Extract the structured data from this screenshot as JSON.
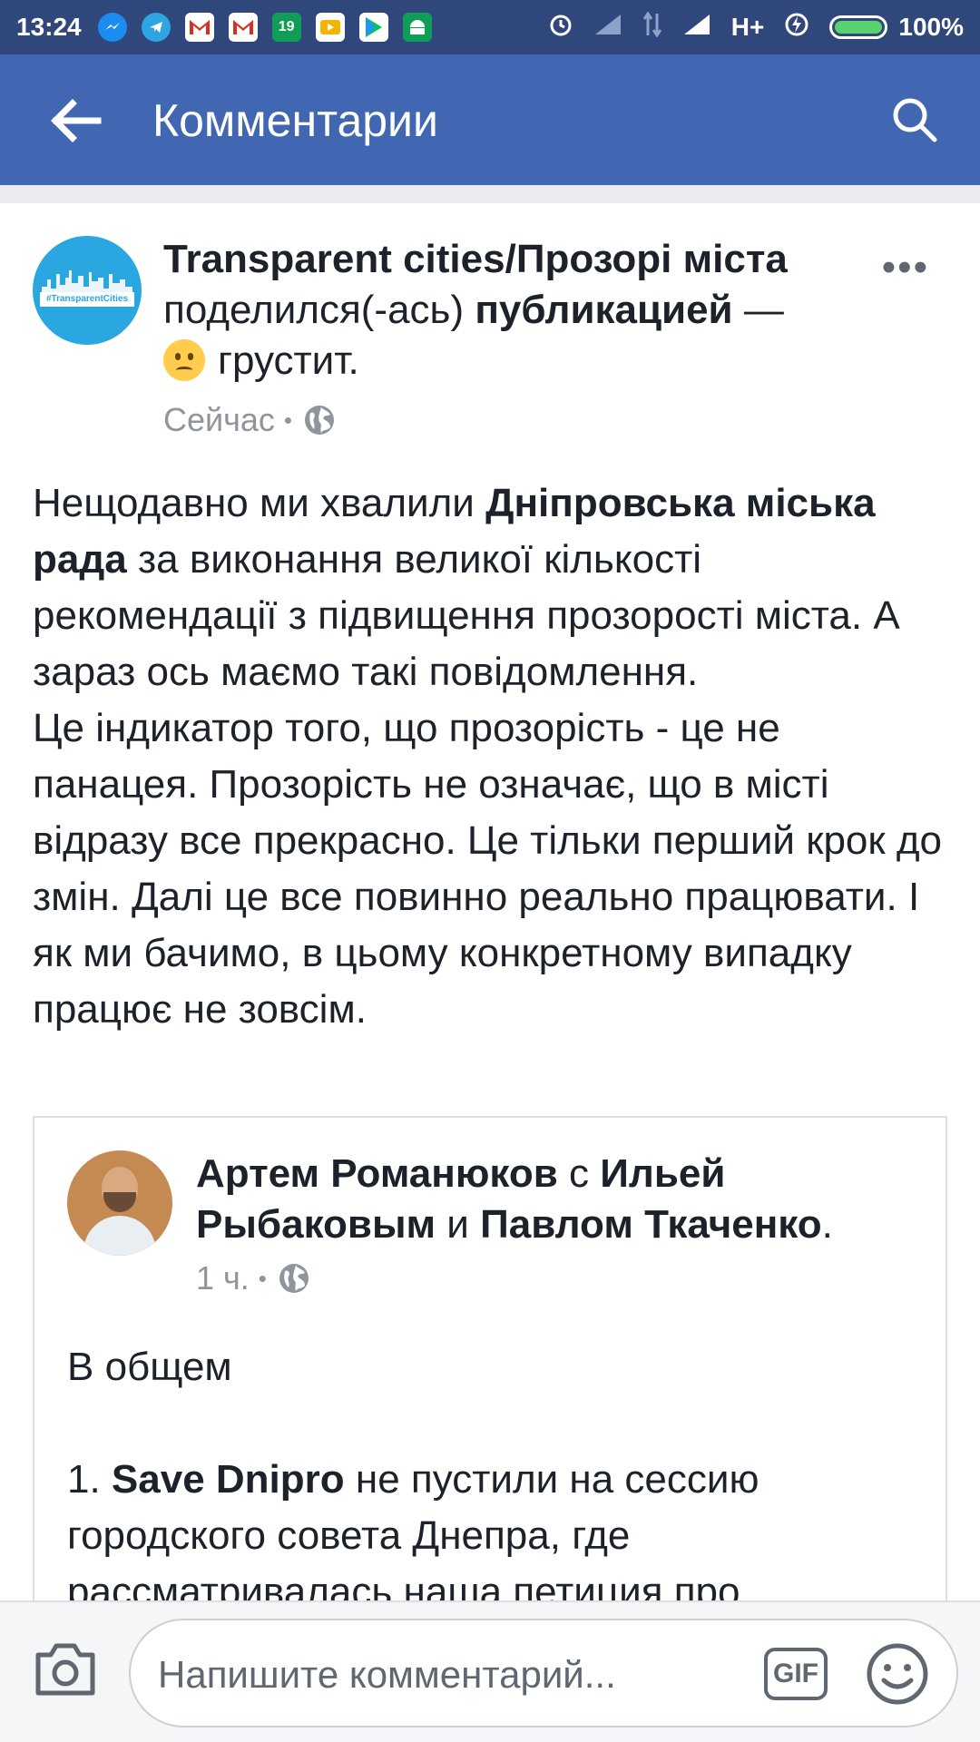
{
  "status_bar": {
    "time": "13:24",
    "notification_icons": [
      "messenger-icon",
      "telegram-icon",
      "gmail-icon",
      "gmail-icon",
      "calendar-icon",
      "slides-icon",
      "play-store-icon",
      "android-icon"
    ],
    "calendar_day": "19",
    "network_label": "H+",
    "battery_percent": "100%"
  },
  "app_bar": {
    "title": "Комментарии",
    "back_icon": "back-arrow-icon",
    "search_icon": "search-icon"
  },
  "post": {
    "author": "Transparent cities/Прозорі міста",
    "action": "поделился(-ась)",
    "object": "публикацией",
    "dash": " —",
    "feeling": "грустит.",
    "time": "Сейчас",
    "separator": "•",
    "avatar_tag": "#TransparentCities",
    "paragraphs": {
      "p1_pre": "Нещодавно ми хвалили ",
      "p1_bold": "Дніпровська міська рада",
      "p1_post": " за виконання великої кількості рекомендації з підвищення прозорості міста. А зараз ось маємо такі повідомлення.",
      "p2": "Це індикатор того, що прозорість - це не панацея. Прозорість не означає, що в місті відразу все прекрасно. Це тільки перший крок до змін. Далі це все повинно реально працювати. І як ми бачимо, в цьому конкретному випадку працює не зовсім."
    }
  },
  "shared_post": {
    "author": "Артем Романюков",
    "with_word": " с ",
    "tagged1": "Ильей Рыбаковым",
    "and_word": " и ",
    "tagged2": "Павлом Ткаченко",
    "period": ".",
    "time": "1 ч.",
    "separator": "•",
    "intro": "В общем",
    "item_number": "1. ",
    "item_bold": "Save Dnipro",
    "item_text": " не пустили на сессию городского совета Днепра, где рассматривалась наша петиция про"
  },
  "comment_bar": {
    "placeholder": "Напишите комментарий...",
    "gif_label": "GIF"
  },
  "colors": {
    "status_bar": "#2f477a",
    "app_bar": "#4267b2",
    "text": "#1d2129",
    "muted": "#90949c"
  }
}
